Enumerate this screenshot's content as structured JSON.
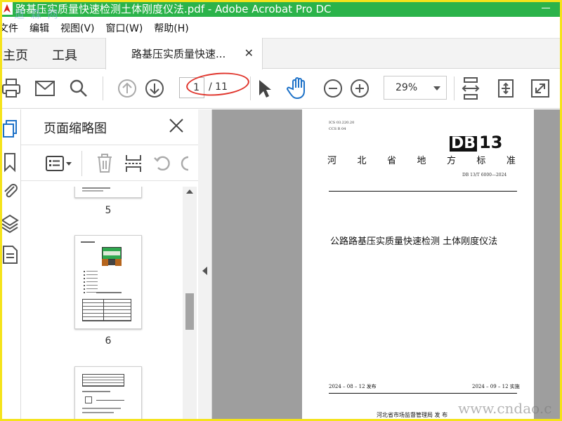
{
  "window": {
    "title": "路基压实质量快速检测土体刚度仪法.pdf - Adobe Acrobat Pro DC",
    "watermark_top": "道 森 网"
  },
  "menu": [
    "文件",
    "编辑",
    "视图(V)",
    "窗口(W)",
    "帮助(H)"
  ],
  "tabs": {
    "home": "主页",
    "tools": "工具",
    "document": "路基压实质量快速..."
  },
  "toolbar": {
    "current_page": "1",
    "total_pages": "/ 11",
    "zoom": "29%"
  },
  "thumbnails_panel": {
    "title": "页面缩略图",
    "pages": [
      {
        "label": "5"
      },
      {
        "label": "6"
      }
    ]
  },
  "document_page": {
    "ics": "ICS  03.220.20",
    "ccs": "CCS  R 04",
    "db_prefix": "DB",
    "db_number": "13",
    "province_chars": [
      "河",
      "北",
      "省",
      "地",
      "方",
      "标",
      "准"
    ],
    "standard_number": "DB 13/T  6000—2024",
    "title": "公路路基压实质量快速检测  土体刚度仪法",
    "issue_date": "2024 – 08 – 12 发布",
    "implement_date": "2024 – 09 – 12 实施",
    "issuer": "河北省市场监督管理局     发  布"
  },
  "watermark_bottom": "www.cndao.c",
  "colors": {
    "titlebar": "#2bb34a",
    "frame": "#f5e31a",
    "annotation": "#e0342b",
    "hand_tool": "#1e72c8",
    "active_rail": "#1e72c8"
  }
}
